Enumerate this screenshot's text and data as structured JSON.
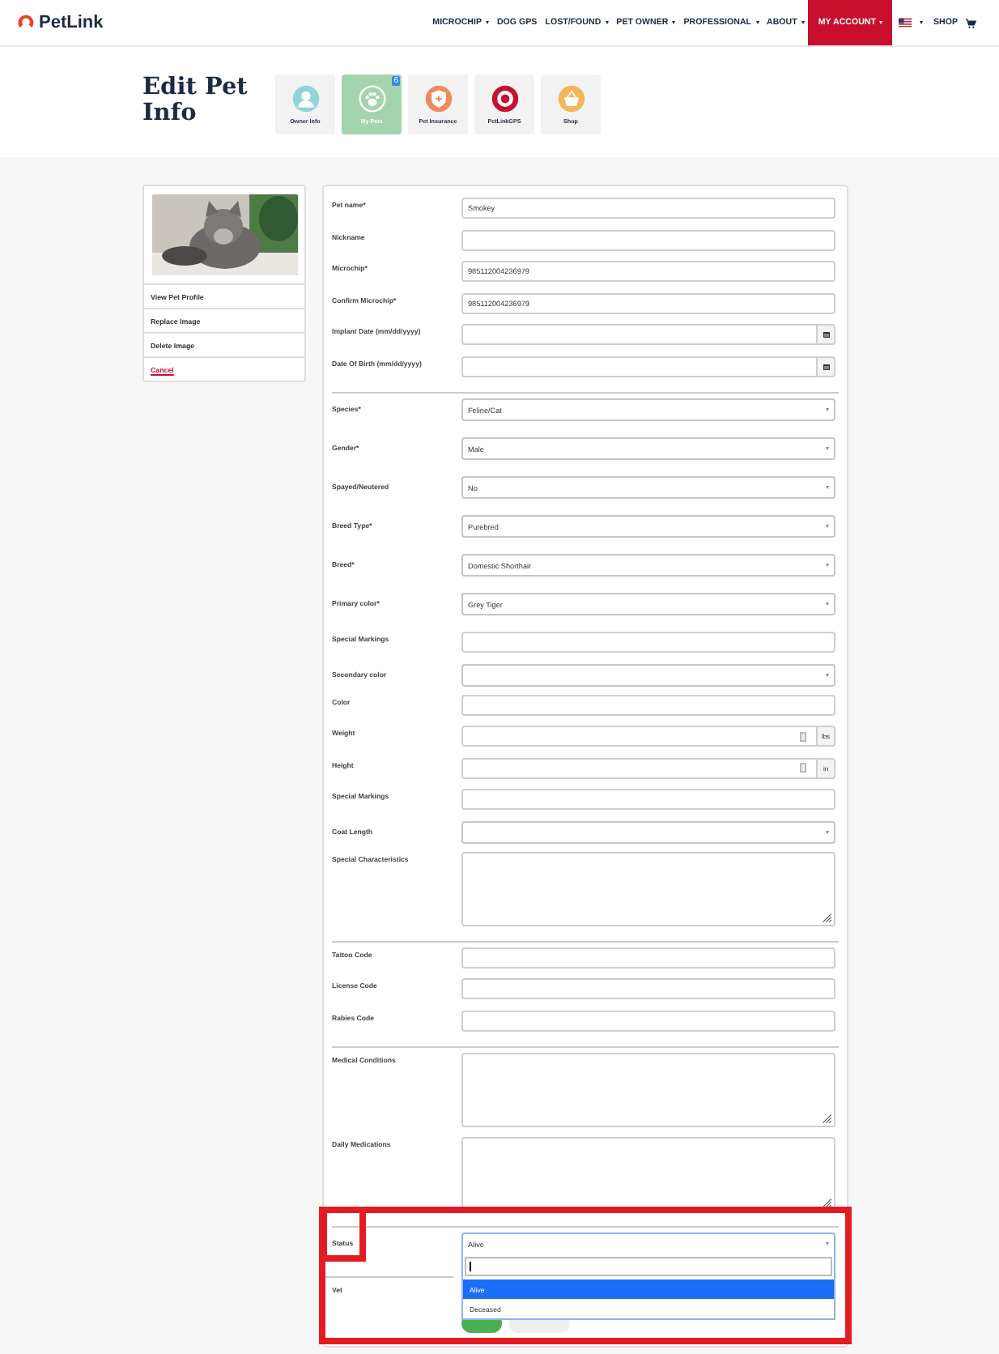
{
  "header": {
    "logo": "PetLink",
    "nav": [
      {
        "label": "MICROCHIP",
        "menu": true,
        "selected": false
      },
      {
        "label": "DOG GPS",
        "menu": false,
        "selected": false
      },
      {
        "label": "LOST/FOUND",
        "menu": true,
        "selected": false
      },
      {
        "label": "PET OWNER",
        "menu": true,
        "selected": false
      },
      {
        "label": "PROFESSIONAL",
        "menu": true,
        "selected": false
      },
      {
        "label": "ABOUT",
        "menu": true,
        "selected": false
      },
      {
        "label": "MY ACCOUNT",
        "menu": true,
        "selected": true
      }
    ],
    "language": {
      "kind": "flag",
      "menu": true
    },
    "shop": "SHOP"
  },
  "page_title": "Edit Pet Info",
  "tabs": [
    {
      "label": "Owner Info",
      "kind": "owner",
      "selected": false
    },
    {
      "label": "My Pets",
      "kind": "pets",
      "selected": true,
      "badge": "6"
    },
    {
      "label": "Pet Insurance",
      "kind": "insurance",
      "selected": false
    },
    {
      "label": "PetLinkGPS",
      "kind": "gps",
      "selected": false
    },
    {
      "label": "Shop",
      "kind": "shop",
      "selected": false
    }
  ],
  "pet_card": {
    "links": [
      {
        "label": "View Pet Profile",
        "kind": "action"
      },
      {
        "label": "Replace Image",
        "kind": "action"
      },
      {
        "label": "Delete Image",
        "kind": "action"
      },
      {
        "label": "Cancel",
        "kind": "link"
      }
    ]
  },
  "form": {
    "sections": [
      {
        "fields": [
          {
            "label": "Pet name*",
            "kind": "text",
            "value": "Smokey"
          },
          {
            "label": "Nickname",
            "kind": "text"
          },
          {
            "label": "Microchip*",
            "kind": "text",
            "value": "985112004236979"
          },
          {
            "label": "Confirm Microchip*",
            "kind": "text",
            "value": "985112004236979"
          },
          {
            "label": "Implant Date (mm/dd/yyyy)",
            "kind": "date"
          },
          {
            "label": "Date Of Birth (mm/dd/yyyy)",
            "kind": "date"
          }
        ]
      },
      {
        "fields": [
          {
            "label": "Species*",
            "kind": "select",
            "value": "Feline/Cat"
          },
          {
            "label": "Gender*",
            "kind": "select",
            "value": "Male"
          },
          {
            "label": "Spayed/Neutered",
            "kind": "select",
            "value": "No"
          },
          {
            "label": "Breed Type*",
            "kind": "select",
            "value": "Purebred"
          },
          {
            "label": "Breed*",
            "kind": "select",
            "value": "Domestic Shorthair"
          },
          {
            "label": "Primary color*",
            "kind": "select",
            "value": "Grey Tiger"
          },
          {
            "label": "Special Markings",
            "kind": "text"
          },
          {
            "label": "Secondary color",
            "kind": "select"
          },
          {
            "label": "Color",
            "kind": "text"
          },
          {
            "label": "Weight",
            "kind": "unit",
            "unit": "lbs"
          },
          {
            "label": "Height",
            "kind": "unit",
            "unit": "in"
          },
          {
            "label": "Special Markings",
            "kind": "text"
          },
          {
            "label": "Coat Length",
            "kind": "select"
          },
          {
            "label": "Special Characteristics",
            "kind": "textarea"
          }
        ]
      },
      {
        "fields": [
          {
            "label": "Tattoo Code",
            "kind": "text"
          },
          {
            "label": "License Code",
            "kind": "text"
          },
          {
            "label": "Rabies Code",
            "kind": "text"
          }
        ]
      },
      {
        "fields": [
          {
            "label": "Medical Conditions",
            "kind": "textarea"
          },
          {
            "label": "Daily Medications",
            "kind": "textarea"
          }
        ]
      },
      {
        "highlighted": true,
        "fields": [
          {
            "label": "Status",
            "kind": "select",
            "value": "Alive",
            "label_highlighted": true,
            "expanded": true,
            "options": [
              {
                "label": "Alive",
                "selected": true
              },
              {
                "label": "Deceased",
                "selected": false
              }
            ]
          },
          {
            "label": "Vet",
            "kind": "label"
          }
        ],
        "buttons": [
          {
            "kind": "primary"
          },
          {
            "kind": "secondary"
          }
        ]
      }
    ]
  }
}
